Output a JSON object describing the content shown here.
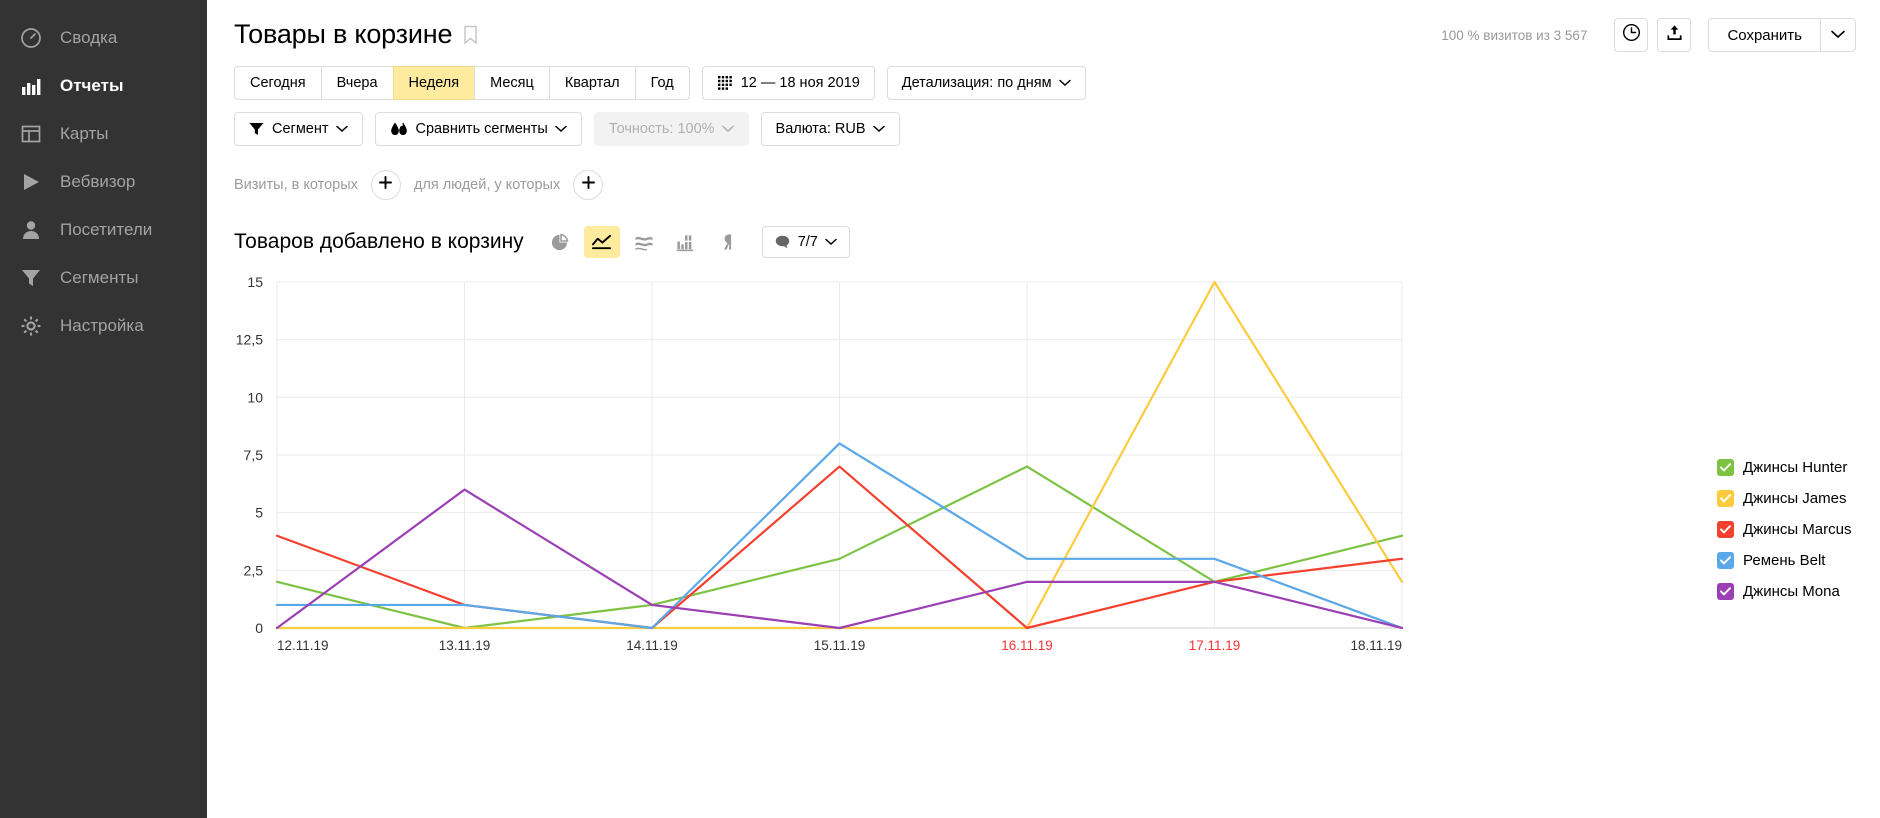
{
  "sidebar": {
    "items": [
      {
        "label": "Сводка",
        "icon": "gauge-icon",
        "active": false
      },
      {
        "label": "Отчеты",
        "icon": "bars-icon",
        "active": true
      },
      {
        "label": "Карты",
        "icon": "layout-icon",
        "active": false
      },
      {
        "label": "Вебвизор",
        "icon": "play-icon",
        "active": false
      },
      {
        "label": "Посетители",
        "icon": "person-icon",
        "active": false
      },
      {
        "label": "Сегменты",
        "icon": "funnel-icon",
        "active": false
      },
      {
        "label": "Настройка",
        "icon": "gear-icon",
        "active": false
      }
    ]
  },
  "header": {
    "title": "Товары в корзине",
    "bookmark_icon": "bookmark-icon",
    "visits_note": "100 % визитов из 3 567",
    "history_icon": "clock-icon",
    "export_icon": "export-icon",
    "save_label": "Сохранить",
    "save_caret_icon": "chevron-down-icon"
  },
  "toolbar": {
    "periods": [
      {
        "label": "Сегодня",
        "selected": false
      },
      {
        "label": "Вчера",
        "selected": false
      },
      {
        "label": "Неделя",
        "selected": true
      },
      {
        "label": "Месяц",
        "selected": false
      },
      {
        "label": "Квартал",
        "selected": false
      },
      {
        "label": "Год",
        "selected": false
      }
    ],
    "date_range": "12 — 18 ноя 2019",
    "calendar_icon": "calendar-icon",
    "detail_label": "Детализация: по дням",
    "segment_label": "Сегмент",
    "segment_icon": "filter-icon",
    "compare_label": "Сравнить сегменты",
    "compare_icon": "compare-icon",
    "accuracy_label": "Точность: 100%",
    "currency_label": "Валюта: RUB"
  },
  "filters": {
    "visits_label": "Визиты, в которых",
    "people_label": "для людей, у которых",
    "add_icon": "plus-icon"
  },
  "chart_head": {
    "title": "Товаров добавлено в корзину",
    "viz": [
      {
        "name": "pie-chart-icon",
        "active": false
      },
      {
        "name": "line-chart-icon",
        "active": true
      },
      {
        "name": "area-chart-icon",
        "active": false
      },
      {
        "name": "bar-chart-icon",
        "active": false
      },
      {
        "name": "map-pin-icon",
        "active": false
      }
    ],
    "metrics_label": "7/7",
    "metrics_icon": "speech-bubble-icon",
    "metrics_caret_icon": "chevron-down-icon"
  },
  "chart_data": {
    "type": "line",
    "title": "Товаров добавлено в корзину",
    "xlabel": "",
    "ylabel": "",
    "ylim": [
      0,
      15
    ],
    "yticks": [
      "0",
      "2,5",
      "5",
      "7,5",
      "10",
      "12,5",
      "15"
    ],
    "ytick_values": [
      0,
      2.5,
      5,
      7.5,
      10,
      12.5,
      15
    ],
    "grid": true,
    "legend_position": "right",
    "categories": [
      "12.11.19",
      "13.11.19",
      "14.11.19",
      "15.11.19",
      "16.11.19",
      "17.11.19",
      "18.11.19"
    ],
    "weekend_categories": [
      "16.11.19",
      "17.11.19"
    ],
    "weekend_color": "#ff3333",
    "series": [
      {
        "name": "Джинсы Hunter",
        "color": "#7DC243",
        "checked": true,
        "values": [
          2,
          0,
          1,
          3,
          7,
          2,
          4
        ]
      },
      {
        "name": "Джинсы James",
        "color": "#FCCB3E",
        "checked": true,
        "values": [
          0,
          0,
          0,
          0,
          0,
          15,
          2
        ]
      },
      {
        "name": "Джинсы Marcus",
        "color": "#F4402F",
        "checked": true,
        "values": [
          4,
          1,
          0,
          7,
          0,
          2,
          3
        ]
      },
      {
        "name": "Ремень Belt",
        "color": "#5BA8E8",
        "checked": true,
        "values": [
          1,
          1,
          0,
          8,
          3,
          3,
          0
        ]
      },
      {
        "name": "Джинсы Mona",
        "color": "#9B3FB5",
        "checked": true,
        "values": [
          0,
          6,
          1,
          0,
          2,
          2,
          0
        ]
      }
    ]
  }
}
